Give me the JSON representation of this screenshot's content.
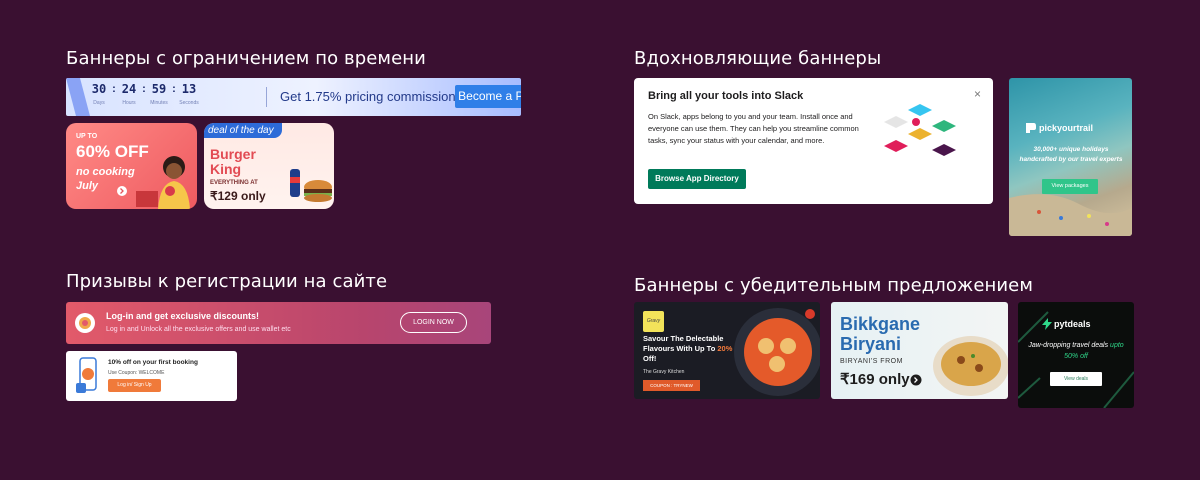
{
  "sections": {
    "time_limited": "Баннеры с ограничением по времени",
    "inspiring": "Вдохновляющие баннеры",
    "signup": "Призывы к регистрации на сайте",
    "persuasive": "Баннеры с убедительным предложением"
  },
  "countdown": {
    "days": "30",
    "hours": "24",
    "minutes": "59",
    "seconds": "13",
    "days_label": "Days",
    "hours_label": "Hours",
    "minutes_label": "Minutes",
    "seconds_label": "Seconds",
    "offer": "Get  1.75% pricing commission",
    "button": "Become a Partner"
  },
  "food60": {
    "up_to": "UP TO",
    "headline": "60% OFF",
    "tagline": "no cooking July"
  },
  "burger": {
    "tag": "deal of the day",
    "headline": "Burger King",
    "everything": "EVERYTHING AT",
    "price": "₹129 only"
  },
  "slack": {
    "title": "Bring all your tools into Slack",
    "body": "On Slack, apps belong to you and your team. Install once and everyone can use them. They can help you streamline common tasks, sync your status with your calendar, and more.",
    "button": "Browse App Directory",
    "close": "×"
  },
  "pickyourtrail": {
    "logo": "pickyourtrail",
    "text": "30,000+ unique holidays handcrafted by our travel experts",
    "button": "View packages"
  },
  "login": {
    "title": "Log-in and get exclusive discounts!",
    "subtitle": "Log in and Unlock all the exclusive offers and use wallet etc",
    "button": "LOGIN NOW"
  },
  "first_booking": {
    "title": "10% off on your first booking",
    "coupon": "Use Coupon: WELCOME",
    "button": "Log in/ Sign Up"
  },
  "gravy": {
    "logo": "Gravy",
    "line1": "Savour The Delectable Flavours With Up To ",
    "highlight": "20%",
    "line2": " Off!",
    "sub": "The Gravy Kitchen",
    "coupon": "COUPON : TRYNEW"
  },
  "biryani": {
    "title": "Bikkgane Biryani",
    "from": "BIRYANI'S FROM",
    "price": "₹169 only"
  },
  "pytdeals": {
    "logo": "pytdeals",
    "text1": "Jaw-dropping travel deals ",
    "highlight": "upto 50% off",
    "button": "View deals"
  },
  "colors": {
    "background": "#3a1031",
    "slack_green": "#007a5a",
    "pyt_green": "#30c58a",
    "partner_blue": "#2f7fe8"
  }
}
